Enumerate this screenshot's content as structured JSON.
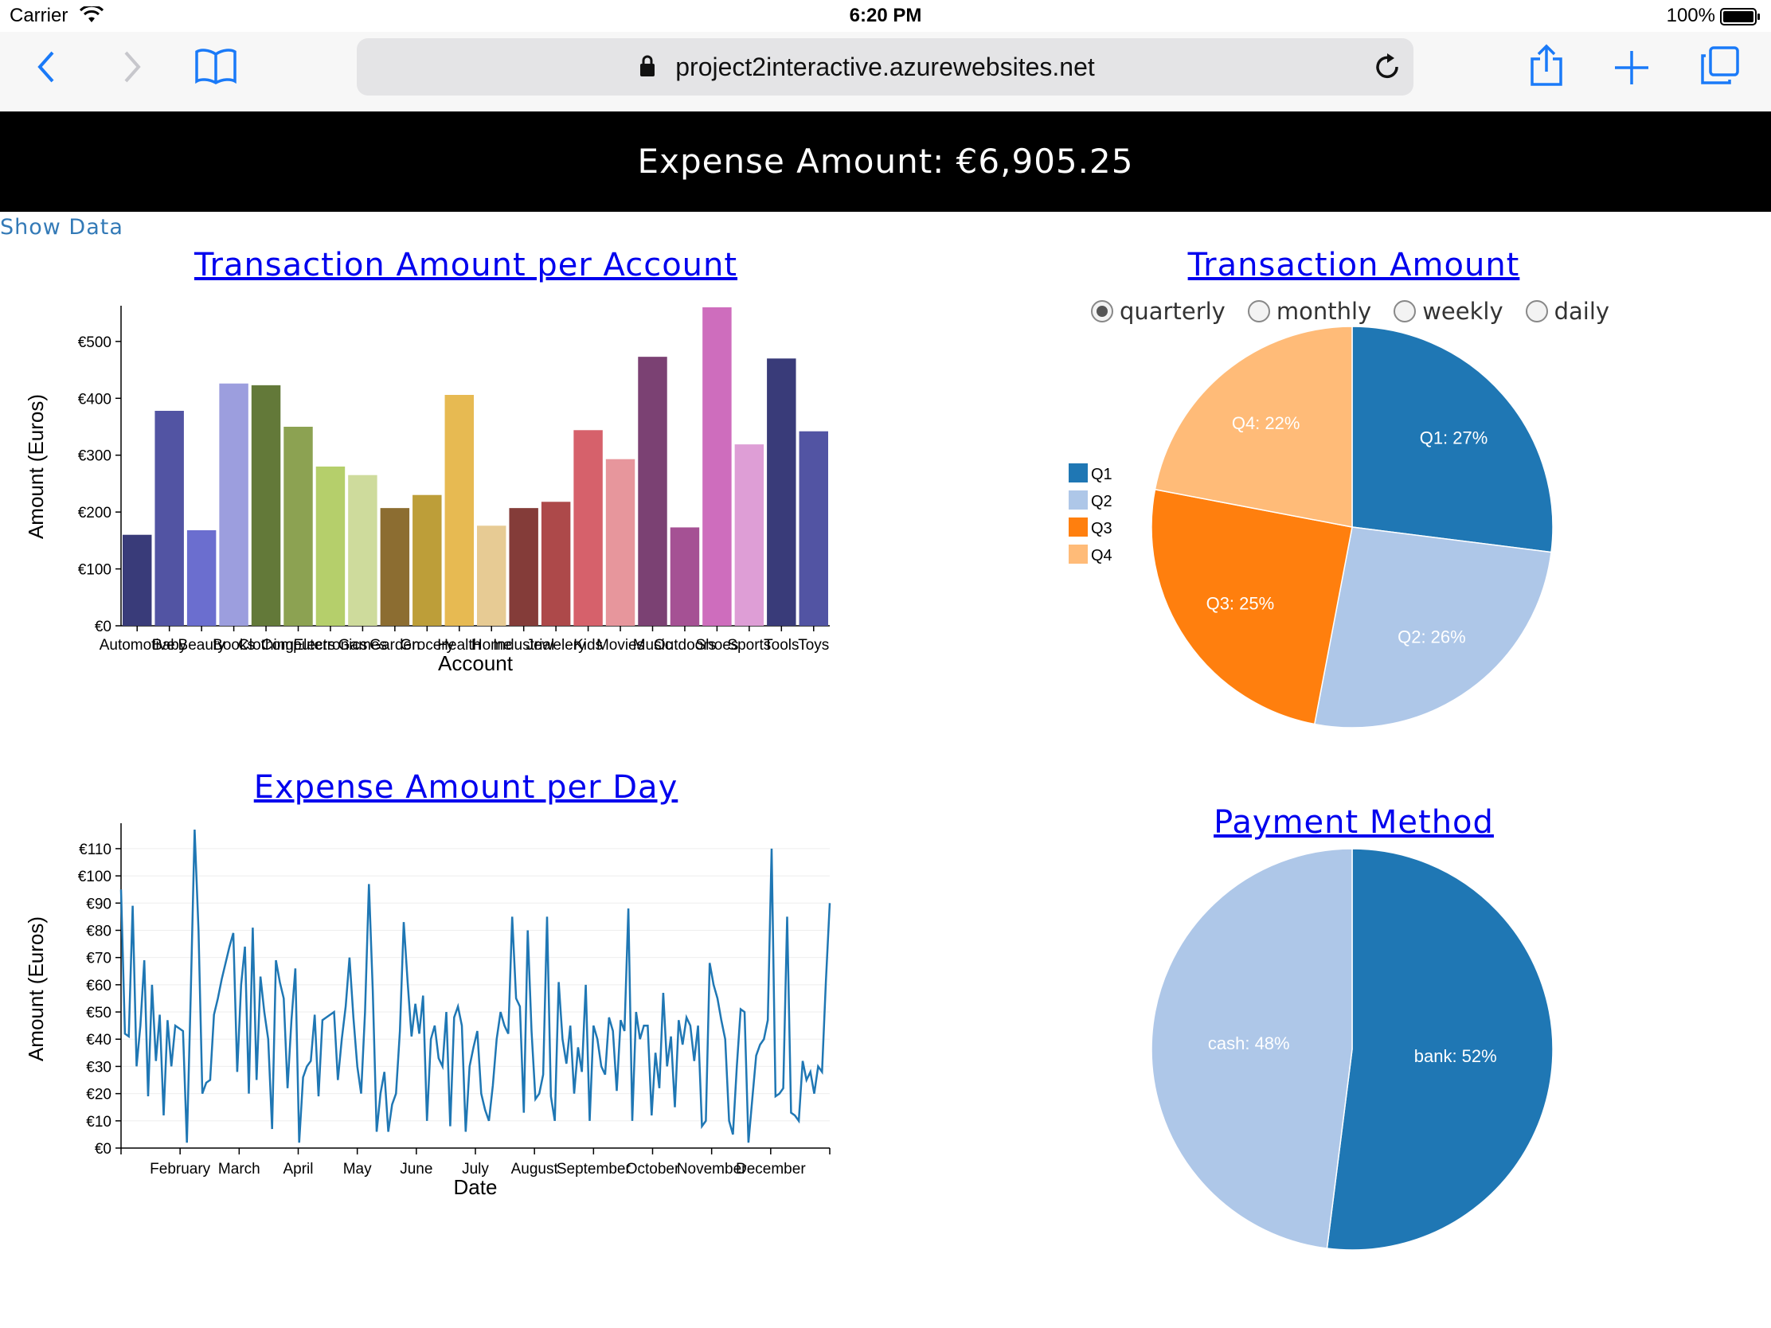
{
  "statusbar": {
    "carrier": "Carrier",
    "time": "6:20 PM",
    "battery": "100%"
  },
  "browser": {
    "url": "project2interactive.azurewebsites.net"
  },
  "header": {
    "expense_label": "Expense Amount: €6,905.25"
  },
  "show_data_link": "Show Data",
  "period_options": [
    {
      "label": "quarterly",
      "selected": true
    },
    {
      "label": "monthly",
      "selected": false
    },
    {
      "label": "weekly",
      "selected": false
    },
    {
      "label": "daily",
      "selected": false
    }
  ],
  "chart_data": [
    {
      "type": "bar",
      "title": "Transaction Amount per Account",
      "xlabel": "Account",
      "ylabel": "Amount (Euros)",
      "ylim": [
        0,
        560
      ],
      "yticks": [
        "€0",
        "€100",
        "€200",
        "€300",
        "€400",
        "€500"
      ],
      "categories": [
        "Automotive",
        "Baby",
        "Beauty",
        "Books",
        "Clothing",
        "Computers",
        "Electronics",
        "Games",
        "Garden",
        "Grocery",
        "Health",
        "Home",
        "Industrial",
        "Jewelery",
        "Kids",
        "Movies",
        "Music",
        "Outdoors",
        "Shoes",
        "Sports",
        "Tools",
        "Toys"
      ],
      "values": [
        160,
        378,
        168,
        426,
        423,
        350,
        280,
        265,
        207,
        230,
        406,
        176,
        207,
        218,
        344,
        293,
        473,
        173,
        560,
        319,
        470,
        342
      ],
      "colors": [
        "#393b79",
        "#5254a3",
        "#6b6ecf",
        "#9c9ede",
        "#637939",
        "#8ca252",
        "#b5cf6b",
        "#cedb9c",
        "#8c6d31",
        "#bd9e39",
        "#e7ba52",
        "#e7cb94",
        "#843c39",
        "#ad494a",
        "#d6616b",
        "#e7969c",
        "#7b4173",
        "#a55194",
        "#ce6dbd",
        "#de9ed6",
        "#393b79",
        "#5254a3"
      ]
    },
    {
      "type": "pie",
      "title": "Transaction Amount",
      "slices": [
        {
          "label": "Q1",
          "value": 27,
          "text": "Q1: 27%",
          "color": "#1f77b4"
        },
        {
          "label": "Q2",
          "value": 26,
          "text": "Q2: 26%",
          "color": "#aec7e8"
        },
        {
          "label": "Q3",
          "value": 25,
          "text": "Q3: 25%",
          "color": "#ff7f0e"
        },
        {
          "label": "Q4",
          "value": 22,
          "text": "Q4: 22%",
          "color": "#ffbb78"
        }
      ],
      "legend": "left"
    },
    {
      "type": "line",
      "title": "Expense Amount per Day",
      "xlabel": "Date",
      "ylabel": "Amount (Euros)",
      "ylim": [
        0,
        117
      ],
      "yticks": [
        "€0",
        "€10",
        "€20",
        "€30",
        "€40",
        "€50",
        "€60",
        "€70",
        "€80",
        "€90",
        "€100",
        "€110"
      ],
      "xticks": [
        "February",
        "March",
        "April",
        "May",
        "June",
        "July",
        "August",
        "September",
        "October",
        "November",
        "December"
      ],
      "color": "#1f77b4",
      "values": [
        95,
        42,
        41,
        89,
        30,
        45,
        69,
        19,
        60,
        32,
        49,
        12,
        47,
        30,
        45,
        44,
        43,
        2,
        56,
        117,
        80,
        20,
        24,
        25,
        49,
        55,
        62,
        68,
        74,
        79,
        28,
        60,
        74,
        20,
        81,
        25,
        63,
        50,
        40,
        7,
        69,
        61,
        55,
        22,
        47,
        66,
        2,
        26,
        30,
        32,
        49,
        19,
        47,
        48,
        49,
        50,
        25,
        40,
        52,
        70,
        48,
        30,
        20,
        50,
        97,
        58,
        6,
        20,
        28,
        6,
        16,
        20,
        43,
        83,
        61,
        41,
        53,
        42,
        56,
        10,
        40,
        45,
        33,
        30,
        50,
        8,
        48,
        52,
        45,
        6,
        30,
        37,
        43,
        20,
        14,
        10,
        23,
        40,
        50,
        45,
        42,
        85,
        55,
        52,
        13,
        80,
        43,
        18,
        20,
        27,
        85,
        19,
        10,
        61,
        40,
        31,
        45,
        20,
        37,
        28,
        60,
        10,
        45,
        40,
        30,
        27,
        48,
        43,
        21,
        47,
        43,
        88,
        10,
        50,
        40,
        45,
        45,
        12,
        35,
        22,
        57,
        30,
        41,
        15,
        47,
        38,
        48,
        45,
        32,
        45,
        8,
        10,
        68,
        60,
        55,
        47,
        40,
        10,
        5,
        30,
        51,
        50,
        2,
        18,
        34,
        38,
        40,
        47,
        110,
        19,
        20,
        22,
        85,
        13,
        12,
        10,
        32,
        25,
        28,
        20,
        30,
        28,
        61,
        90
      ]
    },
    {
      "type": "pie",
      "title": "Payment Method",
      "slices": [
        {
          "label": "bank",
          "value": 52,
          "text": "bank: 52%",
          "color": "#1f77b4"
        },
        {
          "label": "cash",
          "value": 48,
          "text": "cash: 48%",
          "color": "#aec7e8"
        }
      ]
    }
  ]
}
